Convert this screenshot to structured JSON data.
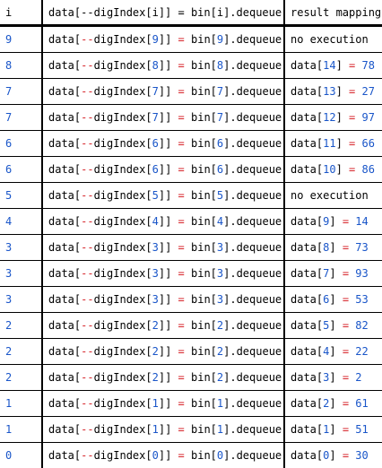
{
  "header": {
    "col_i": "i",
    "col_stmt": "data[--digIndex[i]] = bin[i].dequeue()",
    "col_result": "result mapping"
  },
  "rows": [
    {
      "i": "9",
      "d": "9",
      "b": "9",
      "no_exec": "no execution",
      "pos": "",
      "val": ""
    },
    {
      "i": "8",
      "d": "8",
      "b": "8",
      "no_exec": "",
      "pos": "14",
      "val": "78"
    },
    {
      "i": "7",
      "d": "7",
      "b": "7",
      "no_exec": "",
      "pos": "13",
      "val": "27"
    },
    {
      "i": "7",
      "d": "7",
      "b": "7",
      "no_exec": "",
      "pos": "12",
      "val": "97"
    },
    {
      "i": "6",
      "d": "6",
      "b": "6",
      "no_exec": "",
      "pos": "11",
      "val": "66"
    },
    {
      "i": "6",
      "d": "6",
      "b": "6",
      "no_exec": "",
      "pos": "10",
      "val": "86"
    },
    {
      "i": "5",
      "d": "5",
      "b": "5",
      "no_exec": "no execution",
      "pos": "",
      "val": ""
    },
    {
      "i": "4",
      "d": "4",
      "b": "4",
      "no_exec": "",
      "pos": "9",
      "val": "14"
    },
    {
      "i": "3",
      "d": "3",
      "b": "3",
      "no_exec": "",
      "pos": "8",
      "val": "73"
    },
    {
      "i": "3",
      "d": "3",
      "b": "3",
      "no_exec": "",
      "pos": "7",
      "val": "93"
    },
    {
      "i": "3",
      "d": "3",
      "b": "3",
      "no_exec": "",
      "pos": "6",
      "val": "53"
    },
    {
      "i": "2",
      "d": "2",
      "b": "2",
      "no_exec": "",
      "pos": "5",
      "val": "82"
    },
    {
      "i": "2",
      "d": "2",
      "b": "2",
      "no_exec": "",
      "pos": "4",
      "val": "22"
    },
    {
      "i": "2",
      "d": "2",
      "b": "2",
      "no_exec": "",
      "pos": "3",
      "val": "2"
    },
    {
      "i": "1",
      "d": "1",
      "b": "1",
      "no_exec": "",
      "pos": "2",
      "val": "61"
    },
    {
      "i": "1",
      "d": "1",
      "b": "1",
      "no_exec": "",
      "pos": "1",
      "val": "51"
    },
    {
      "i": "0",
      "d": "0",
      "b": "0",
      "no_exec": "",
      "pos": "0",
      "val": "30"
    }
  ],
  "colors": {
    "index_blue": "#1a56c9",
    "operator_red": "#d7262c",
    "text": "#000000",
    "rule": "#000000"
  }
}
